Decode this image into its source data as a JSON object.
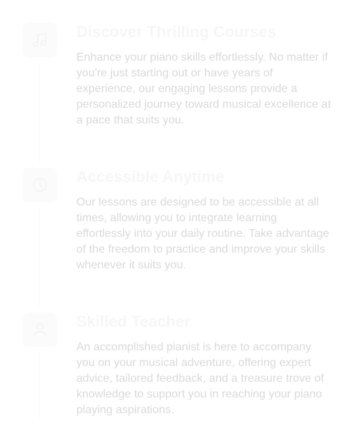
{
  "features": [
    {
      "icon": "music-note-icon",
      "title": "Discover Thrilling Courses",
      "description": "Enhance your piano skills effortlessly. No matter if you're just starting out or have years of experience, our engaging lessons provide a personalized journey toward musical excellence at a pace that suits you."
    },
    {
      "icon": "clock-icon",
      "title": "Accessible Anytime",
      "description": "Our lessons are designed to be accessible at all times, allowing you to integrate learning effortlessly into your daily routine. Take advantage of the freedom to practice and improve your skills whenever it suits you."
    },
    {
      "icon": "teacher-icon",
      "title": "Skilled Teacher",
      "description": "An accomplished pianist is here to accompany you on your musical adventure, offering expert advice, tailored feedback, and a treasure trove of knowledge to support you in reaching your piano playing aspirations."
    }
  ],
  "colors": {
    "title": "#f6f6f6",
    "description": "#dadada",
    "icon_bg": "#fbfbfb"
  }
}
